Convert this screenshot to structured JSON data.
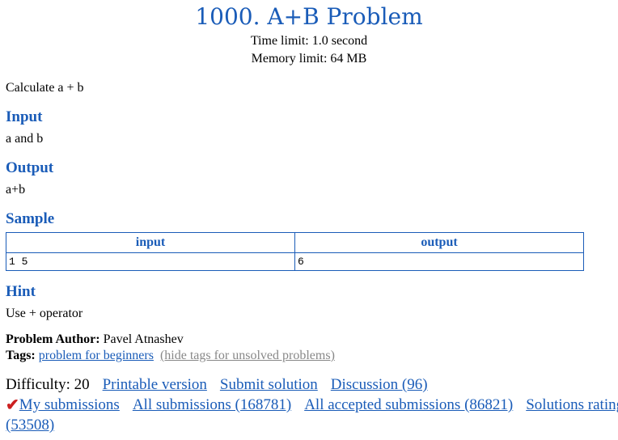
{
  "problem": {
    "title": "1000. A+B Problem",
    "time_limit": "Time limit: 1.0 second",
    "memory_limit": "Memory limit: 64 MB",
    "statement": "Calculate a + b"
  },
  "sections": {
    "input_heading": "Input",
    "input_text": "a and b",
    "output_heading": "Output",
    "output_text": "a+b",
    "sample_heading": "Sample",
    "hint_heading": "Hint",
    "hint_text": "Use + operator"
  },
  "sample_table": {
    "headers": [
      "input",
      "output"
    ],
    "rows": [
      [
        "1 5",
        "6"
      ]
    ]
  },
  "meta": {
    "author_label": "Problem Author:",
    "author_name": "Pavel Atnashev",
    "tags_label": "Tags:",
    "tag": "problem for beginners",
    "hide_tags": "(hide tags for unsolved problems)"
  },
  "footer": {
    "difficulty": "Difficulty: 20",
    "printable": "Printable version",
    "submit": "Submit solution",
    "discussion": "Discussion (96)",
    "check_icon": "checkmark-icon",
    "my_submissions": "My submissions",
    "all_submissions": "All submissions (168781)",
    "all_accepted": "All accepted submissions (86821)",
    "rating_part1": "Solutions rating",
    "rating_part2": "(53508)"
  },
  "colors": {
    "accent": "#1a5cb8",
    "muted_link": "#888888",
    "check": "#cc2020"
  }
}
